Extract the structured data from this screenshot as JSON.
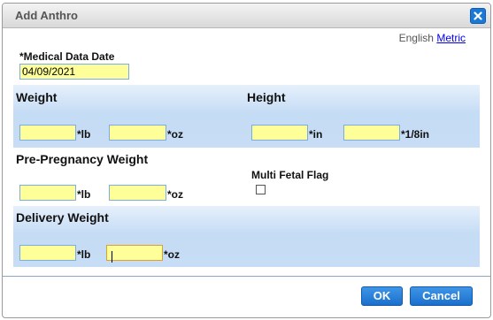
{
  "dialog": {
    "title": "Add Anthro",
    "close_icon": "close-icon"
  },
  "units": {
    "english_label": "English",
    "metric_label": "Metric"
  },
  "medical_date": {
    "label": "*Medical Data Date",
    "value": "04/09/2021"
  },
  "weight": {
    "title": "Weight",
    "lb_value": "",
    "lb_unit": "*lb",
    "oz_value": "",
    "oz_unit": "*oz"
  },
  "height": {
    "title": "Height",
    "in_value": "",
    "in_unit": "*in",
    "eighth_value": "",
    "eighth_unit": "*1/8in"
  },
  "pre_pregnancy": {
    "title": "Pre-Pregnancy Weight",
    "lb_value": "",
    "lb_unit": "*lb",
    "oz_value": "",
    "oz_unit": "*oz"
  },
  "multi_fetal": {
    "label": "Multi Fetal Flag",
    "checked": false
  },
  "delivery": {
    "title": "Delivery Weight",
    "lb_value": "",
    "lb_unit": "*lb",
    "oz_value": "",
    "oz_unit": "*oz"
  },
  "buttons": {
    "ok": "OK",
    "cancel": "Cancel"
  },
  "colors": {
    "accent": "#1a6fcc",
    "field_bg": "#ffff99",
    "band": "#c5dcf5"
  }
}
